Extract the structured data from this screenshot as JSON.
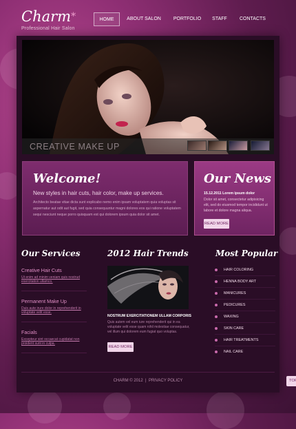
{
  "brand": {
    "logo": "Charm",
    "logo_mark": "*",
    "tagline": "Professional Hair Salon"
  },
  "nav": [
    {
      "label": "HOME",
      "active": true
    },
    {
      "label": "ABOUT SALON",
      "active": false
    },
    {
      "label": "PORTFOLIO",
      "active": false
    },
    {
      "label": "STAFF",
      "active": false
    },
    {
      "label": "CONTACTS",
      "active": false
    }
  ],
  "hero": {
    "caption": "CREATIVE MAKE UP"
  },
  "welcome": {
    "title": "Welcome!",
    "subtitle": "New styles in hair cuts, hair color, make up services.",
    "body": "Architecto beatae vitae dicta sunt explicabo nemo enim ipsam voluptatem quia voluptas sit aspernatur aut odit aut fugit, sed quia consequuntur magni dolores eos qui ratione voluptatem sequi nesciunt neque porro quisquam est qui dolorem ipsum quia dolor sit amet."
  },
  "news": {
    "title": "Our News",
    "date": "15.12.2011",
    "date_caption": "Lorem ipsum dolor",
    "body": "Dolor sit amet, consectetur adipisicing elit, sed do eiusmod tempor incididunt ut labore et dolore magna aliqua.",
    "button": "READ MORE"
  },
  "services": {
    "title": "Our Services",
    "items": [
      {
        "name": "Creative Hair Cuts",
        "desc": "Ut enim ad minim veniam quis nostrud exercitation ullamco."
      },
      {
        "name": "Permanent Make Up",
        "desc": "Duis aute irure dolor in reprehenderit in voluptate velit esse."
      },
      {
        "name": "Facials",
        "desc": "Excepteur sint occaecat cupidatat non proident sunt in culpa."
      }
    ]
  },
  "trends": {
    "title": "2012 Hair Trends",
    "headline": "NOSTRUM EXERCITATIONEM ULLAM CORPORIS",
    "body": "Quis autem vel eum iure reprehenderit qui in ea voluptate velit esse quam nihil molestiae consequatur, vel illum qui dolorem eum fugiat quo voluptas.",
    "button": "READ MORE"
  },
  "popular": {
    "title": "Most Popular",
    "items": [
      "HAIR COLORING",
      "HENNA BODY ART",
      "MANICURES",
      "PEDICURES",
      "WAXING",
      "SKIN CARE",
      "HAIR TREATMENTS",
      "NAIL CARE"
    ]
  },
  "footer": {
    "copyright": "CHARM © 2012",
    "separator": "|",
    "policy": "PRIVACY POLICY"
  },
  "to_top": "TOP",
  "colors": {
    "accent": "#c24f9c",
    "panel": "#2a0d26",
    "button": "#f1d5e9"
  }
}
